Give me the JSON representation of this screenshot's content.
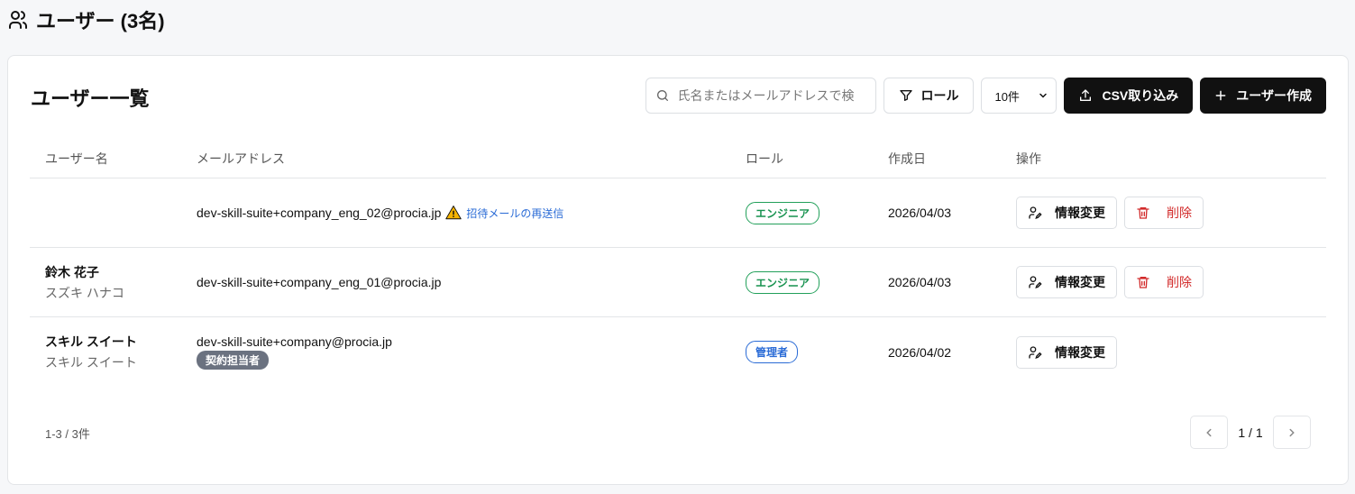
{
  "page": {
    "title": "ユーザー (3名)"
  },
  "card": {
    "title": "ユーザー一覧"
  },
  "toolbar": {
    "search_placeholder": "氏名またはメールアドレスで検",
    "role_filter_label": "ロール",
    "page_size_value": "10件",
    "csv_import_label": "CSV取り込み",
    "create_user_label": "ユーザー作成"
  },
  "table": {
    "headers": [
      "ユーザー名",
      "メールアドレス",
      "ロール",
      "作成日",
      "操作"
    ],
    "rows": [
      {
        "name": "",
        "kana": "",
        "email": "dev-skill-suite+company_eng_02@procia.jp",
        "resend_label": "招待メールの再送信",
        "role": "エンジニア",
        "created": "2026/04/03",
        "edit_label": "情報変更",
        "delete_label": "削除"
      },
      {
        "name": "鈴木 花子",
        "kana": "スズキ ハナコ",
        "email": "dev-skill-suite+company_eng_01@procia.jp",
        "role": "エンジニア",
        "created": "2026/04/03",
        "edit_label": "情報変更",
        "delete_label": "削除"
      },
      {
        "name": "スキル スイート",
        "kana": "スキル スイート",
        "email": "dev-skill-suite+company@procia.jp",
        "badge": "契約担当者",
        "role": "管理者",
        "created": "2026/04/02",
        "edit_label": "情報変更"
      }
    ]
  },
  "pagination": {
    "count_text": "1-3 / 3件",
    "page_info": "1 / 1"
  },
  "colors": {
    "accent_dark": "#111111",
    "role_engineer": "#17924f",
    "role_admin": "#2a6bd6",
    "danger": "#d22b2b",
    "link": "#2a6bd6"
  }
}
